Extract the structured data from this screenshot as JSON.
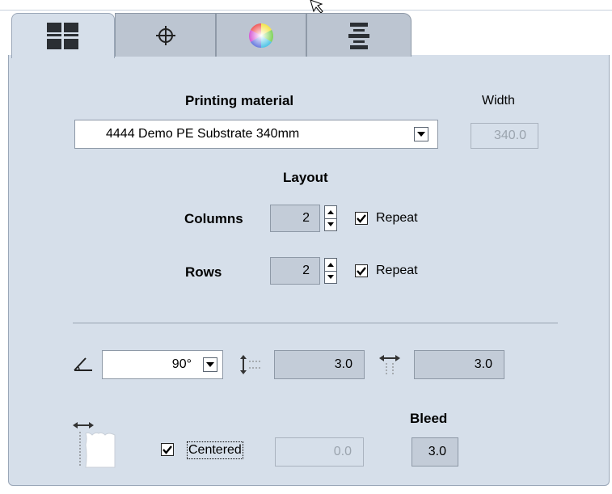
{
  "tabs": [
    {
      "icon": "grid-layout-icon",
      "active": true
    },
    {
      "icon": "crosshair-icon",
      "active": false
    },
    {
      "icon": "color-wheel-icon",
      "active": false
    },
    {
      "icon": "align-bars-icon",
      "active": false
    }
  ],
  "material": {
    "label": "Printing material",
    "value": "4444 Demo PE Substrate 340mm",
    "width_label": "Width",
    "width_value": "340.0"
  },
  "layout": {
    "title": "Layout",
    "columns_label": "Columns",
    "columns_value": "2",
    "columns_repeat_label": "Repeat",
    "columns_repeat_checked": true,
    "rows_label": "Rows",
    "rows_value": "2",
    "rows_repeat_label": "Repeat",
    "rows_repeat_checked": true
  },
  "spacing": {
    "angle_value": "90°",
    "vertical_gap": "3.0",
    "horizontal_gap": "3.0"
  },
  "bleed": {
    "title": "Bleed",
    "centered_label": "Centered",
    "centered_checked": true,
    "offset_value": "0.0",
    "bleed_value": "3.0"
  }
}
